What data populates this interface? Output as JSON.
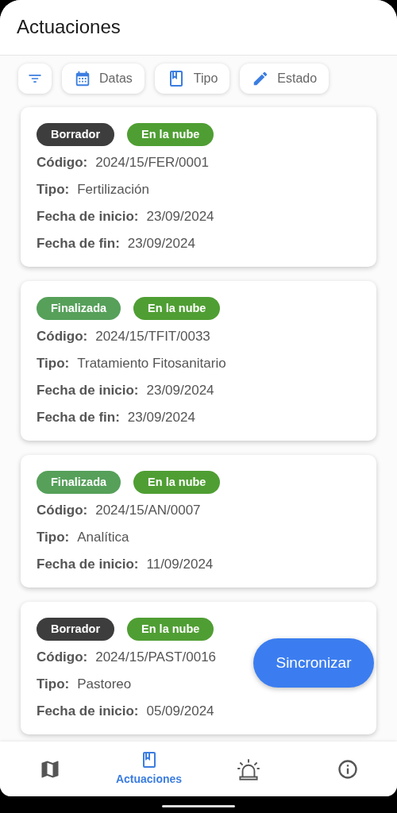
{
  "header": {
    "title": "Actuaciones"
  },
  "filters": [
    {
      "kind": "filter"
    },
    {
      "kind": "calendar",
      "label": "Datas"
    },
    {
      "kind": "book",
      "label": "Tipo"
    },
    {
      "kind": "pencil",
      "label": "Estado"
    }
  ],
  "cards": [
    {
      "badges": [
        {
          "label": "Borrador",
          "color": "#3d3d3d"
        },
        {
          "label": "En la nube",
          "color": "#4f9e33"
        }
      ],
      "fields": [
        {
          "label": "Código:",
          "value": "2024/15/FER/0001"
        },
        {
          "label": "Tipo:",
          "value": "Fertilización"
        },
        {
          "label": "Fecha de inicio:",
          "value": "23/09/2024"
        },
        {
          "label": "Fecha de fin:",
          "value": "23/09/2024"
        }
      ]
    },
    {
      "badges": [
        {
          "label": "Finalizada",
          "color": "#56a05a"
        },
        {
          "label": "En la nube",
          "color": "#4f9e33"
        }
      ],
      "fields": [
        {
          "label": "Código:",
          "value": "2024/15/TFIT/0033"
        },
        {
          "label": "Tipo:",
          "value": "Tratamiento Fitosanitario"
        },
        {
          "label": "Fecha de inicio:",
          "value": "23/09/2024"
        },
        {
          "label": "Fecha de fin:",
          "value": "23/09/2024"
        }
      ]
    },
    {
      "badges": [
        {
          "label": "Finalizada",
          "color": "#56a05a"
        },
        {
          "label": "En la nube",
          "color": "#4f9e33"
        }
      ],
      "fields": [
        {
          "label": "Código:",
          "value": "2024/15/AN/0007"
        },
        {
          "label": "Tipo:",
          "value": "Analítica"
        },
        {
          "label": "Fecha de inicio:",
          "value": "11/09/2024"
        }
      ]
    },
    {
      "badges": [
        {
          "label": "Borrador",
          "color": "#3d3d3d"
        },
        {
          "label": "En la nube",
          "color": "#4f9e33"
        }
      ],
      "fields": [
        {
          "label": "Código:",
          "value": "2024/15/PAST/0016"
        },
        {
          "label": "Tipo:",
          "value": "Pastoreo"
        },
        {
          "label": "Fecha de inicio:",
          "value": "05/09/2024"
        }
      ]
    }
  ],
  "sync_button": {
    "label": "Sincronizar"
  },
  "nav": [
    {
      "kind": "map",
      "selected": false
    },
    {
      "kind": "book",
      "label": "Actuaciones",
      "selected": true
    },
    {
      "kind": "alarm",
      "selected": false
    },
    {
      "kind": "info",
      "selected": false
    }
  ]
}
